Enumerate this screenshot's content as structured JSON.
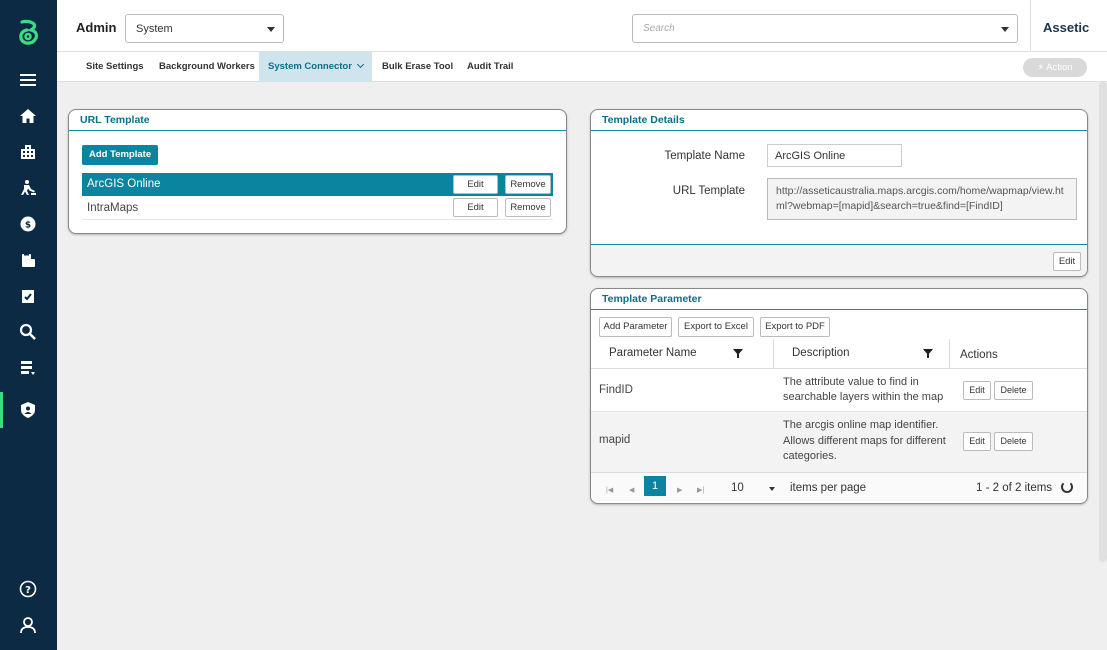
{
  "header": {
    "admin_label": "Admin",
    "system_select_value": "System",
    "search_placeholder": "Search",
    "brand": "Assetic"
  },
  "tabs": [
    {
      "label": "Site Settings"
    },
    {
      "label": "Background Workers"
    },
    {
      "label": "System Connector"
    },
    {
      "label": "Bulk Erase Tool"
    },
    {
      "label": "Audit Trail"
    }
  ],
  "action_button": "⚡ Action",
  "sidebar_icons": [
    "menu-icon",
    "home-icon",
    "building-icon",
    "worker-icon",
    "globe-dollar-icon",
    "clipboard-icon",
    "checklist-icon",
    "search-icon",
    "document-list-icon",
    "shield-user-icon",
    "help-icon",
    "user-icon"
  ],
  "url_template": {
    "title": "URL Template",
    "add_button": "Add Template",
    "rows": [
      {
        "name": "ArcGIS Online",
        "edit": "Edit",
        "remove": "Remove"
      },
      {
        "name": "IntraMaps",
        "edit": "Edit",
        "remove": "Remove"
      }
    ]
  },
  "template_details": {
    "title": "Template Details",
    "name_label": "Template Name",
    "name_value": "ArcGIS Online",
    "url_label": "URL Template",
    "url_value": "http://asseticaustralia.maps.arcgis.com/home/wapmap/view.html?webmap=[mapid]&search=true&find=[FindID]",
    "edit_button": "Edit"
  },
  "template_parameter": {
    "title": "Template Parameter",
    "toolbar": {
      "add": "Add Parameter",
      "excel": "Export to Excel",
      "pdf": "Export to PDF"
    },
    "columns": {
      "name": "Parameter Name",
      "description": "Description",
      "actions": "Actions"
    },
    "rows": [
      {
        "name": "FindID",
        "description": "The attribute value to find in searchable layers within the map",
        "edit": "Edit",
        "delete": "Delete"
      },
      {
        "name": "mapid",
        "description": "The arcgis online map identifier. Allows different maps for different categories.",
        "edit": "Edit",
        "delete": "Delete"
      }
    ],
    "pager": {
      "page": "1",
      "page_size": "10",
      "items_per_page": "items per page",
      "summary": "1 - 2 of 2 items"
    }
  },
  "colors": {
    "sidebar": "#0c2a44",
    "accent": "#0b84a0",
    "logo": "#3ddc84"
  }
}
